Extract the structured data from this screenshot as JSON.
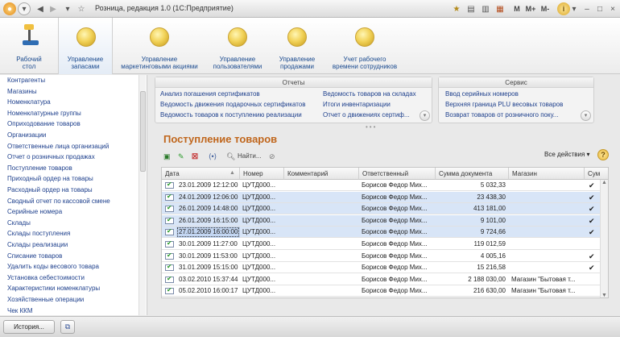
{
  "window": {
    "title": "Розница, редакция 1.0  (1С:Предприятие)",
    "mem_labels": [
      "M",
      "M+",
      "M-"
    ],
    "controls": [
      "–",
      "□",
      "×"
    ]
  },
  "sections": [
    {
      "label": "Рабочий\nстол",
      "icon": "desk-icon"
    },
    {
      "label": "Управление\nзапасами",
      "icon": "coin-icon"
    },
    {
      "label": "Управление\nмаркетинговыми акциями",
      "icon": "coin-icon"
    },
    {
      "label": "Управление\nпользователями",
      "icon": "coin-icon"
    },
    {
      "label": "Управление\nпродажами",
      "icon": "coin-icon"
    },
    {
      "label": "Учет рабочего\nвремени сотрудников",
      "icon": "coin-icon"
    }
  ],
  "nav": {
    "items": [
      "Контрагенты",
      "Магазины",
      "Номенклатура",
      "Номенклатурные группы",
      "Оприходование товаров",
      "Организации",
      "Ответственные лица организаций",
      "Отчет о розничных продажах",
      "Поступление товаров",
      "Приходный ордер на товары",
      "Расходный ордер на товары",
      "Сводный отчет по кассовой смене",
      "Серийные номера",
      "Склады",
      "Склады поступления",
      "Склады реализации",
      "Списание товаров",
      "Удалить коды весового товара",
      "Установка себестоимости",
      "Характеристики номенклатуры",
      "Хозяйственные операции",
      "Чек ККМ"
    ]
  },
  "reports": {
    "title": "Отчеты",
    "col1": [
      "Анализ погашения сертификатов",
      "Ведомость движения подарочных сертификатов",
      "Ведомость товаров к поступлению реализации"
    ],
    "col2": [
      "Ведомость товаров на складах",
      "Итоги инвентаризации",
      "Отчет о движениях сертиф..."
    ]
  },
  "service": {
    "title": "Сервис",
    "items": [
      "Ввод серийных номеров",
      "Верхняя граница PLU весовых товаров",
      "Возврат товаров от розничного поку..."
    ]
  },
  "form": {
    "title": "Поступление товаров",
    "find_label": "Найти...",
    "all_actions": "Все действия ▾",
    "help": "?"
  },
  "grid": {
    "columns": [
      "Дата",
      "Номер",
      "Комментарий",
      "Ответственный",
      "Сумма документа",
      "Магазин",
      "Сум"
    ],
    "rows": [
      {
        "date": "23.01.2009 12:12:00",
        "number": "ЦУТД000...",
        "comment": "",
        "resp": "Борисов Федор Мих...",
        "sum": "5 032,33",
        "shop": "",
        "check": true,
        "selected": false
      },
      {
        "date": "24.01.2009 12:06:00",
        "number": "ЦУТД000...",
        "comment": "",
        "resp": "Борисов Федор Мих...",
        "sum": "23 438,30",
        "shop": "",
        "check": true,
        "selected": true
      },
      {
        "date": "26.01.2009 14:48:00",
        "number": "ЦУТД000...",
        "comment": "",
        "resp": "Борисов Федор Мих...",
        "sum": "413 181,00",
        "shop": "",
        "check": true,
        "selected": true
      },
      {
        "date": "26.01.2009 16:15:00",
        "number": "ЦУТД000...",
        "comment": "",
        "resp": "Борисов Федор Мих...",
        "sum": "9 101,00",
        "shop": "",
        "check": true,
        "selected": true
      },
      {
        "date": "27.01.2009 16:00:00",
        "number": "ЦУТД000...",
        "comment": "",
        "resp": "Борисов Федор Мих...",
        "sum": "9 724,66",
        "shop": "",
        "check": true,
        "selected": true
      },
      {
        "date": "30.01.2009 11:27:00",
        "number": "ЦУТД000...",
        "comment": "",
        "resp": "Борисов Федор Мих...",
        "sum": "119 012,59",
        "shop": "",
        "check": false,
        "selected": false
      },
      {
        "date": "30.01.2009 11:53:00",
        "number": "ЦУТД000...",
        "comment": "",
        "resp": "Борисов Федор Мих...",
        "sum": "4 005,16",
        "shop": "",
        "check": true,
        "selected": false
      },
      {
        "date": "31.01.2009 15:15:00",
        "number": "ЦУТД000...",
        "comment": "",
        "resp": "Борисов Федор Мих...",
        "sum": "15 216,58",
        "shop": "",
        "check": true,
        "selected": false
      },
      {
        "date": "03.02.2010 15:37:44",
        "number": "ЦУТД000...",
        "comment": "",
        "resp": "Борисов Федор Мих...",
        "sum": "2 188 030,00",
        "shop": "Магазин \"Бытовая т...",
        "check": false,
        "selected": false
      },
      {
        "date": "05.02.2010 16:00:17",
        "number": "ЦУТД000...",
        "comment": "",
        "resp": "Борисов Федор Мих...",
        "sum": "216 630,00",
        "shop": "Магазин \"Бытовая т...",
        "check": false,
        "selected": false
      }
    ]
  },
  "bottom": {
    "history": "История..."
  },
  "colors": {
    "accent_orange": "#c0661c",
    "link_blue": "#1d3f8c",
    "selection": "#d8e5f7"
  }
}
